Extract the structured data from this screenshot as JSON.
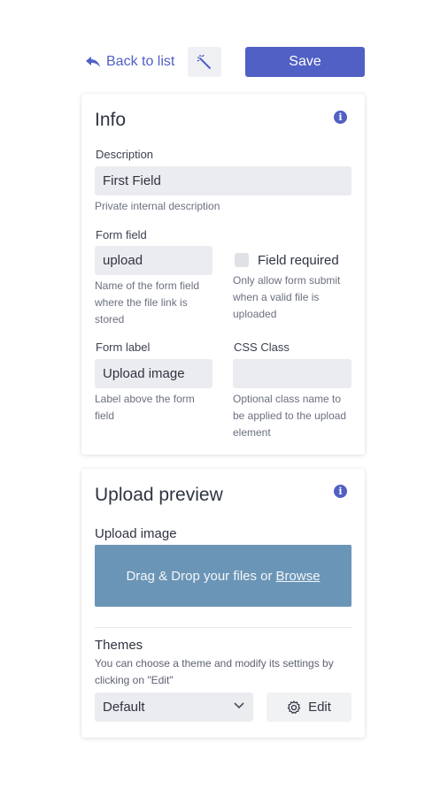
{
  "toolbar": {
    "back_label": "Back to list",
    "back_icon": "reply-arrow-icon",
    "magic_icon": "magic-wand-icon",
    "save_label": "Save",
    "accent_color": "#5160c4"
  },
  "info_card": {
    "title": "Info",
    "info_icon_glyph": "i",
    "description": {
      "label": "Description",
      "value": "First Field",
      "help": "Private internal description"
    },
    "form_field": {
      "label": "Form field",
      "value": "upload",
      "help_lines": [
        "Name of the form field",
        "where the file link is",
        "stored"
      ]
    },
    "field_required": {
      "label": "Field required",
      "checked": false,
      "help_lines": [
        "Only allow form submit",
        "when a valid file is",
        "uploaded"
      ]
    },
    "form_label": {
      "label": "Form label",
      "value": "Upload image",
      "help_lines": [
        "Label above the form",
        "field"
      ]
    },
    "css_class": {
      "label": "CSS Class",
      "value": "",
      "help_lines": [
        "Optional class name to",
        "be applied to the upload",
        "element"
      ]
    }
  },
  "preview_card": {
    "title": "Upload preview",
    "info_icon_glyph": "i",
    "upload_label": "Upload image",
    "dropzone_text": "Drag & Drop your files or",
    "dropzone_link": "Browse",
    "dropzone_color": "#6b95b6",
    "themes": {
      "label": "Themes",
      "help_lines": [
        "You can choose a theme and modify its settings by",
        "clicking on \"Edit\""
      ],
      "selected": "Default",
      "edit_label": "Edit",
      "edit_icon": "gear-icon"
    }
  }
}
